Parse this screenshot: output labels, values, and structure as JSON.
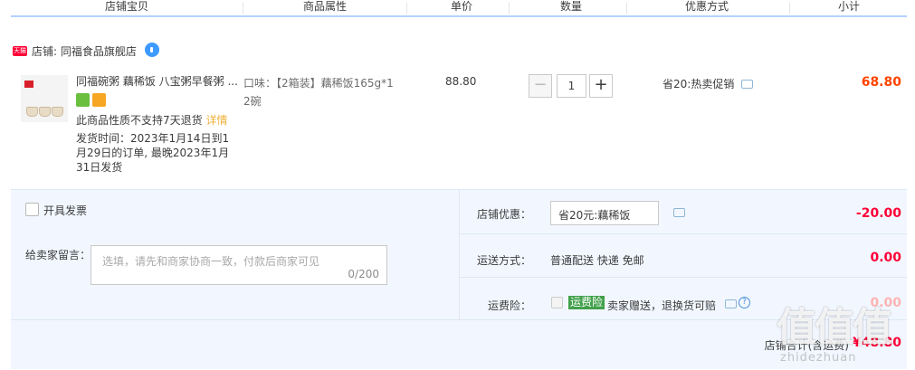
{
  "header": {
    "cols": [
      "店铺宝贝",
      "商品属性",
      "单价",
      "数量",
      "优惠方式",
      "小计"
    ]
  },
  "shop": {
    "tmall_tag": "天猫",
    "label": "店铺: 同福食品旗舰店"
  },
  "item": {
    "title": "同福碗粥 藕稀饭 八宝粥早餐粥 ...",
    "policy": "此商品性质不支持7天退货",
    "policy_link": "详情",
    "ship_line1": "发货时间：2023年1月14日到1",
    "ship_line2": "月29日的订单, 最晚2023年1月",
    "ship_line3": "31日发货",
    "prop_line1": "口味：【2箱装】藕稀饭165g*1",
    "prop_line2": "2碗",
    "price": "88.80",
    "qty": "1",
    "qty_minus": "−",
    "qty_plus": "+",
    "promo": "省20:热卖促销",
    "subtotal": "68.80"
  },
  "invoice": {
    "label": "开具发票"
  },
  "message": {
    "label": "给卖家留言：",
    "placeholder": "选填，请先和商家协商一致，付款后商家可见",
    "counter": "0/200"
  },
  "shop_discount": {
    "label": "店铺优惠：",
    "selected": "省20元:藕稀饭",
    "amount": "-20.00"
  },
  "shipping": {
    "label": "运送方式：",
    "value": "普通配送 快递 免邮",
    "amount": "0.00"
  },
  "insurance": {
    "label": "运费险：",
    "tag": "运费险",
    "value": "卖家赠送，退换货可赔",
    "amount": "0.00"
  },
  "total": {
    "label": "店铺合计(含运费)",
    "value": "¥48.80"
  },
  "watermark": {
    "main": "值值值",
    "sub": "zhidezhuan"
  },
  "colors": {
    "accent": "#ff0036",
    "header_border": "#b2d1ff",
    "panel_bg": "#f2f7ff"
  }
}
